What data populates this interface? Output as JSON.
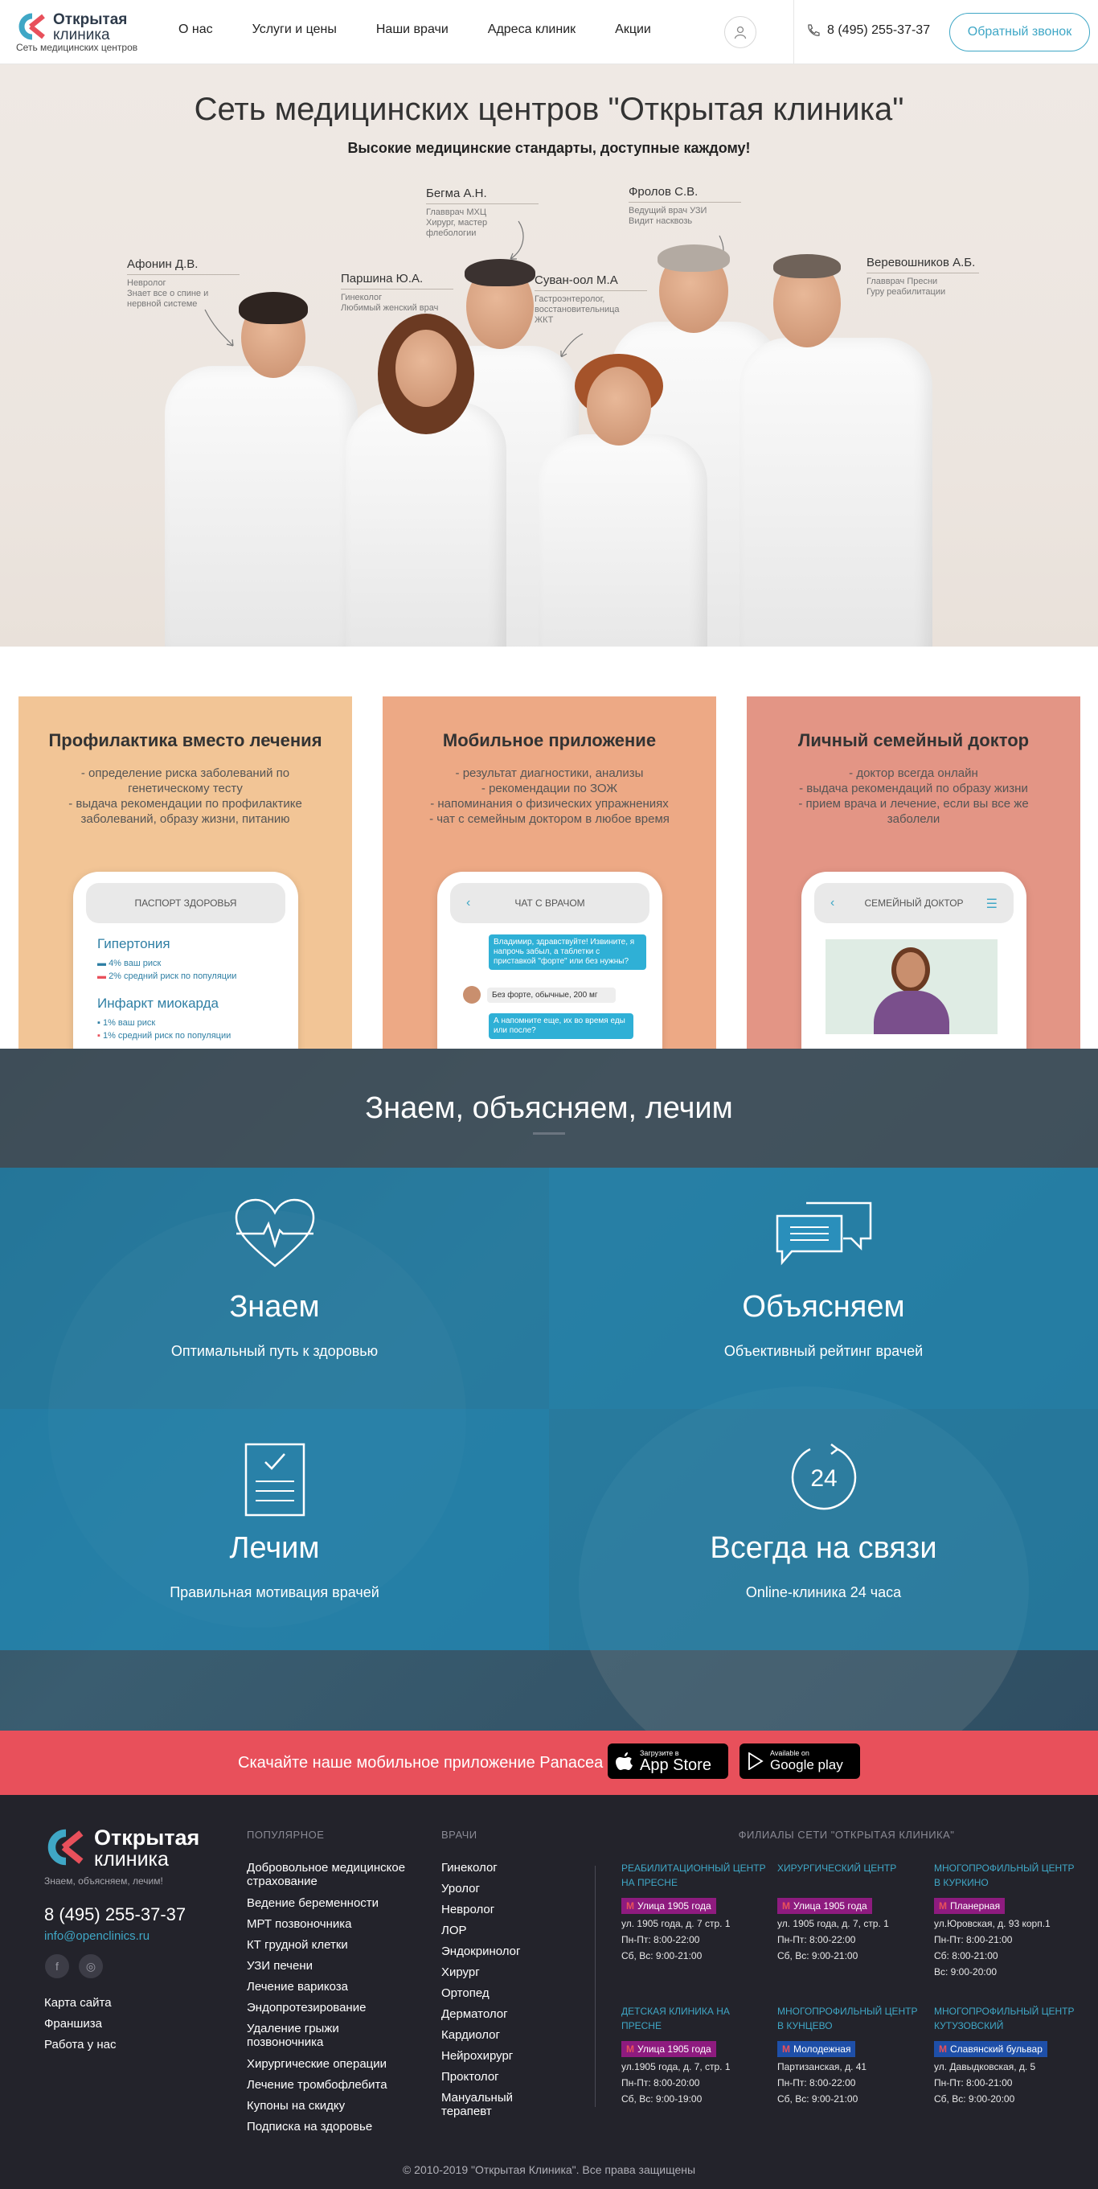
{
  "header": {
    "logo": {
      "name_bold": "Открытая",
      "name_light": "клиника",
      "tagline": "Сеть медицинских центров"
    },
    "nav": [
      "О нас",
      "Услуги и цены",
      "Наши врачи",
      "Адреса клиник",
      "Акции"
    ],
    "phone": "8 (495) 255-37-37",
    "callback_label": "Обратный звонок",
    "accent": "#3fa7c6"
  },
  "hero": {
    "title": "Сеть медицинских центров \"Открытая клиника\"",
    "subtitle": "Высокие медицинские стандарты, доступные каждому!",
    "doctors": [
      {
        "name": "Афонин Д.В.",
        "desc": [
          "Невролог",
          "Знает все о спине и",
          "нервной системе"
        ]
      },
      {
        "name": "Паршина Ю.А.",
        "desc": [
          "Гинеколог",
          "Любимый женский врач"
        ]
      },
      {
        "name": "Бегма А.Н.",
        "desc": [
          "Главврач МХЦ",
          "Хирург, мастер",
          "флебологии"
        ]
      },
      {
        "name": "Суван-оол М.А",
        "desc": [
          "Гастроэнтеролог,",
          "восстановительница",
          "ЖКТ"
        ]
      },
      {
        "name": "Фролов С.В.",
        "desc": [
          "Ведущий врач УЗИ",
          "Видит насквозь"
        ]
      },
      {
        "name": "Веревошников А.Б.",
        "desc": [
          "Главврач Пресни",
          "Гуру реабилитации"
        ]
      }
    ]
  },
  "cards": [
    {
      "title": "Профилактика вместо лечения",
      "lines": [
        "- определение риска заболеваний по",
        "генетическому тесту",
        "- выдача рекомендации по профилактике",
        "заболеваний, образу жизни, питанию"
      ],
      "color": "#f2c596",
      "phone": {
        "header": "ПАСПОРТ ЗДОРОВЬЯ",
        "items": [
          {
            "name": "Гипертония",
            "a": "4% ваш риск",
            "b": "2% средний риск по популяции"
          },
          {
            "name": "Инфаркт миокарда",
            "a": "1% ваш риск",
            "b": "1% средний риск по популяции"
          }
        ]
      }
    },
    {
      "title": "Мобильное приложение",
      "lines": [
        "- результат диагностики, анализы",
        "- рекомендации по ЗОЖ",
        "- напоминания о физических упражнениях",
        "- чат с семейным доктором в любое время"
      ],
      "color": "#eda985",
      "phone": {
        "header": "ЧАТ С ВРАЧОМ",
        "msgs": [
          "Владимир, здравствуйте! Извините, я напрочь забыл, а таблетки с приставкой \"форте\" или без нужны?",
          "Без форте, обычные, 200 мг",
          "А напомните еще, их во время еды или после?"
        ]
      }
    },
    {
      "title": "Личный семейный доктор",
      "lines": [
        "- доктор всегда онлайн",
        "- выдача рекомендаций по образу жизни",
        "- прием врача и лечение, если вы все же",
        "заболели"
      ],
      "color": "#e39585",
      "phone": {
        "header": "СЕМЕЙНЫЙ ДОКТОР"
      }
    }
  ],
  "features": {
    "title": "Знаем, объясняем, лечим",
    "items": [
      {
        "title": "Знаем",
        "sub": "Оптимальный путь к здоровью",
        "icon": "heart-pulse-icon"
      },
      {
        "title": "Объясняем",
        "sub": "Объективный рейтинг врачей",
        "icon": "chat-bubbles-icon"
      },
      {
        "title": "Лечим",
        "sub": "Правильная мотивация врачей",
        "icon": "checklist-icon"
      },
      {
        "title": "Всегда на связи",
        "sub": "Online-клиника 24 часа",
        "icon": "clock-24-icon",
        "num": "24"
      }
    ]
  },
  "app_bar": {
    "text": "Скачайте наше мобильное приложение Panacea",
    "appstore_small": "Загрузите в",
    "appstore_big": "App Store",
    "google_small": "Available on",
    "google_big": "Google play",
    "color": "#e8505b"
  },
  "footer": {
    "slogan": "Знаем, объясняем, лечим!",
    "phone": "8 (495) 255-37-37",
    "email": "info@openclinics.ru",
    "links": [
      "Карта сайта",
      "Франшиза",
      "Работа у нас"
    ],
    "popular_title": "ПОПУЛЯРНОЕ",
    "popular": [
      "Добровольное медицинское страхование",
      "Ведение беременности",
      "МРТ позвоночника",
      "КТ грудной клетки",
      "УЗИ печени",
      "Лечение варикоза",
      "Эндопротезирование",
      "Удаление грыжи позвоночника",
      "Хирургические операции",
      "Лечение тромбофлебита",
      "Купоны на скидку",
      "Подписка на здоровье"
    ],
    "doctors_title": "ВРАЧИ",
    "doctors": [
      "Гинеколог",
      "Уролог",
      "Невролог",
      "ЛОР",
      "Эндокринолог",
      "Хирург",
      "Ортопед",
      "Дерматолог",
      "Кардиолог",
      "Нейрохирург",
      "Проктолог",
      "Мануальный терапевт"
    ],
    "branches_title": "ФИЛИАЛЫ СЕТИ \"ОТКРЫТАЯ КЛИНИКА\"",
    "branches": [
      {
        "name": "РЕАБИЛИТАЦИОННЫЙ ЦЕНТР НА ПРЕСНЕ",
        "metro": "Улица 1905 года",
        "metro_color": "#8e1b7f",
        "addr": "ул. 1905 года, д. 7 стр. 1",
        "h1": "Пн-Пт: 8:00-22:00",
        "h2": "Сб, Вс: 9:00-21:00"
      },
      {
        "name": "ХИРУРГИЧЕСКИЙ ЦЕНТР",
        "metro": "Улица 1905 года",
        "metro_color": "#8e1b7f",
        "addr": "ул. 1905 года, д. 7, стр. 1",
        "h1": "Пн-Пт: 8:00-22:00",
        "h2": "Сб, Вс: 9:00-21:00"
      },
      {
        "name": "МНОГОПРОФИЛЬНЫЙ ЦЕНТР В КУРКИНО",
        "metro": "Планерная",
        "metro_color": "#8e1b7f",
        "addr": "ул.Юровская, д. 93 корп.1",
        "h1": "Пн-Пт: 8:00-21:00",
        "h2": "Сб: 8:00-21:00",
        "h3": "Вс: 9:00-20:00"
      },
      {
        "name": "ДЕТСКАЯ КЛИНИКА НА ПРЕСНЕ",
        "metro": "Улица 1905 года",
        "metro_color": "#8e1b7f",
        "addr": "ул.1905 года, д. 7, стр. 1",
        "h1": "Пн-Пт: 8:00-20:00",
        "h2": "Сб, Вс: 9:00-19:00"
      },
      {
        "name": "МНОГОПРОФИЛЬНЫЙ ЦЕНТР В КУНЦЕВО",
        "metro": "Молодежная",
        "metro_color": "#1e4fa8",
        "addr": "Партизанская, д. 41",
        "h1": "Пн-Пт: 8:00-22:00",
        "h2": "Сб, Вс: 9:00-21:00"
      },
      {
        "name": "МНОГОПРОФИЛЬНЫЙ ЦЕНТР КУТУЗОВСКИЙ",
        "metro": "Славянский бульвар",
        "metro_color": "#1e4fa8",
        "addr": "ул. Давыдковская, д. 5",
        "h1": "Пн-Пт: 8:00-21:00",
        "h2": "Сб, Вс: 9:00-20:00"
      }
    ],
    "copyright": "© 2010-2019 \"Открытая Клиника\". Все права защищены"
  }
}
